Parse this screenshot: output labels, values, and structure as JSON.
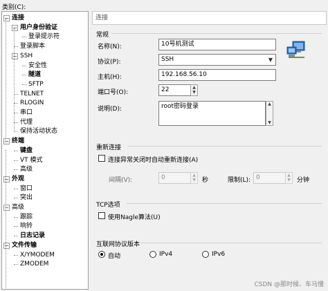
{
  "category_label": "类别(C):",
  "tree": [
    {
      "label": "连接",
      "bold": true,
      "level": 0,
      "expander": "−"
    },
    {
      "label": "用户身份验证",
      "bold": true,
      "level": 1,
      "expander": "−"
    },
    {
      "label": "登录提示符",
      "bold": false,
      "level": 2
    },
    {
      "label": "登录脚本",
      "bold": false,
      "level": 1
    },
    {
      "label": "SSH",
      "bold": false,
      "level": 1,
      "expander": "−"
    },
    {
      "label": "安全性",
      "bold": false,
      "level": 2
    },
    {
      "label": "隧道",
      "bold": true,
      "level": 2
    },
    {
      "label": "SFTP",
      "bold": false,
      "level": 2
    },
    {
      "label": "TELNET",
      "bold": false,
      "level": 1
    },
    {
      "label": "RLOGIN",
      "bold": false,
      "level": 1
    },
    {
      "label": "串口",
      "bold": false,
      "level": 1
    },
    {
      "label": "代理",
      "bold": false,
      "level": 1
    },
    {
      "label": "保持活动状态",
      "bold": false,
      "level": 1
    },
    {
      "label": "终端",
      "bold": true,
      "level": 0,
      "expander": "−"
    },
    {
      "label": "键盘",
      "bold": true,
      "level": 1
    },
    {
      "label": "VT 模式",
      "bold": false,
      "level": 1
    },
    {
      "label": "高级",
      "bold": false,
      "level": 1
    },
    {
      "label": "外观",
      "bold": true,
      "level": 0,
      "expander": "−"
    },
    {
      "label": "窗口",
      "bold": false,
      "level": 1
    },
    {
      "label": "突出",
      "bold": false,
      "level": 1
    },
    {
      "label": "高级",
      "bold": false,
      "level": 0,
      "expander": "−"
    },
    {
      "label": "跟踪",
      "bold": false,
      "level": 1
    },
    {
      "label": "响铃",
      "bold": false,
      "level": 1
    },
    {
      "label": "日志记录",
      "bold": true,
      "level": 1
    },
    {
      "label": "文件传输",
      "bold": true,
      "level": 0,
      "expander": "−"
    },
    {
      "label": "X/YMODEM",
      "bold": false,
      "level": 1
    },
    {
      "label": "ZMODEM",
      "bold": false,
      "level": 1
    }
  ],
  "header_title": "连接",
  "general": {
    "title": "常规",
    "name_label": "名称(N):",
    "name_value": "10号机测试",
    "protocol_label": "协议(P):",
    "protocol_value": "SSH",
    "host_label": "主机(H):",
    "host_value": "192.168.56.10",
    "port_label": "端口号(O):",
    "port_value": "22",
    "desc_label": "说明(D):",
    "desc_value": "root密码登录"
  },
  "reconnect": {
    "title": "重新连接",
    "checkbox_label": "连接异常关闭时自动重新连接(A)",
    "interval_label": "间隔(V):",
    "interval_value": "0",
    "interval_unit": "秒",
    "limit_label": "限制(L):",
    "limit_value": "0",
    "limit_unit": "分钟"
  },
  "tcp": {
    "title": "TCP选项",
    "nagle_label": "使用Nagle算法(U)"
  },
  "ip": {
    "title": "互联网协议版本",
    "auto_label": "自动",
    "ipv4_label": "IPv4",
    "ipv6_label": "IPv6"
  },
  "watermark": "CSDN @那时候、车马慢"
}
